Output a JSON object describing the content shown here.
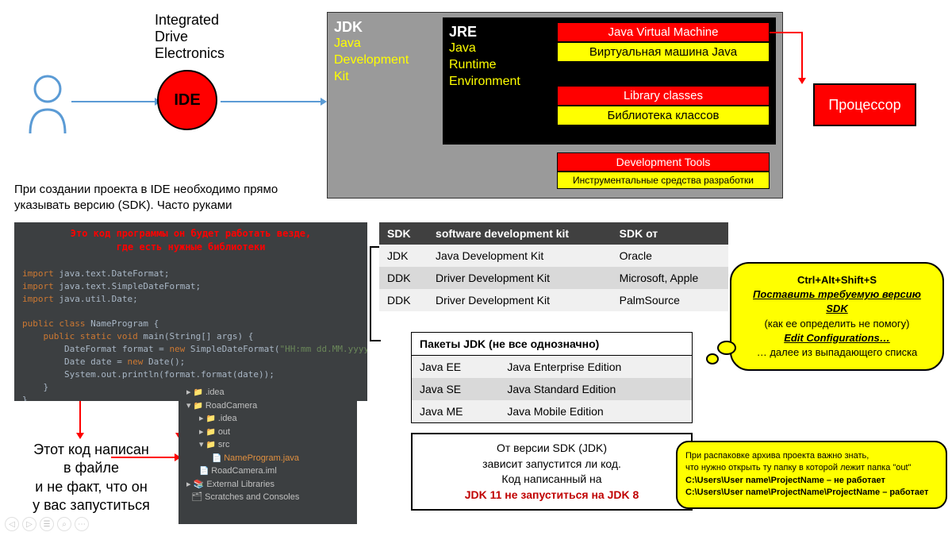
{
  "ide": {
    "abbr": "IDE",
    "full": "Integrated\nDrive\nElectronics"
  },
  "jdk": {
    "title": "JDK",
    "sub": "Java\nDevelopment\nKit"
  },
  "jre": {
    "title": "JRE",
    "sub": "Java\nRuntime\nEnvironment"
  },
  "jvm": {
    "en": "Java Virtual Machine",
    "ru": "Виртуальная машина Java"
  },
  "lib": {
    "en": "Library classes",
    "ru": "Библиотека классов"
  },
  "dev": {
    "en": "Development Tools",
    "ru": "Инструментальные средства разработки"
  },
  "processor": "Процессор",
  "note_ide": "При создании проекта в IDE необходимо прямо указывать версию (SDK). Часто руками",
  "code": {
    "comment1": "Это код программы он будет работать везде,",
    "comment2": "где есть нужные библиотеки",
    "l1": "import java.text.DateFormat;",
    "l2": "import java.text.SimpleDateFormat;",
    "l3": "import java.util.Date;",
    "l4": "public class NameProgram {",
    "l5": "    public static void main(String[] args) {",
    "l6": "        DateFormat format = new SimpleDateFormat(\"HH:mm dd.MM.yyyy\");",
    "l7": "        Date date = new Date();",
    "l8": "        System.out.println(format.format(date));",
    "l9": "    }",
    "l10": "}"
  },
  "tree": {
    "t1": ".idea",
    "t2": "RoadCamera",
    "t3": ".idea",
    "t4": "out",
    "t5": "src",
    "t6": "NameProgram.java",
    "t7": "RoadCamera.iml",
    "t8": "External Libraries",
    "t9": "Scratches and Consoles"
  },
  "note_code": "Этот код написан\nв файле\nи не факт, что он\nу вас запуститься",
  "sdk_table": {
    "h1": "SDK",
    "h2": "software development kit",
    "h3": "SDK от",
    "rows": [
      {
        "a": "JDK",
        "b": "Java Development Kit",
        "c": "Oracle"
      },
      {
        "a": "DDK",
        "b": "Driver Development Kit",
        "c": "Microsoft, Apple"
      },
      {
        "a": "DDK",
        "b": "Driver Development Kit",
        "c": "PalmSource"
      }
    ]
  },
  "pkg_table": {
    "h": "Пакеты JDK (не все однозначно)",
    "rows": [
      {
        "a": "Java EE",
        "b": "Java Enterprise Edition"
      },
      {
        "a": "Java SE",
        "b": "Java Standard Edition"
      },
      {
        "a": "Java ME",
        "b": "Java Mobile Edition"
      }
    ]
  },
  "warn": {
    "l1": "От версии SDK (JDK)",
    "l2": "зависит запустится ли код.",
    "l3": "Код написанный на",
    "l4": "JDK 11 не запуститься на JDK 8"
  },
  "bubble1": {
    "l1": "Ctrl+Alt+Shift+S",
    "l2": "Поставить требуемую версию SDK",
    "l3": "(как ее определить не помогу)",
    "l4": "Edit Configurations…",
    "l5": "… далее из выпадающего списка"
  },
  "bubble2": {
    "l1": "При распаковке архива проекта важно знать,",
    "l2": "что нужно открыть ту папку в которой лежит папка \"out\"",
    "l3": "C:\\Users\\User name\\ProjectName – не работает",
    "l4": "C:\\Users\\User name\\ProjectName\\ProjectName – работает"
  }
}
